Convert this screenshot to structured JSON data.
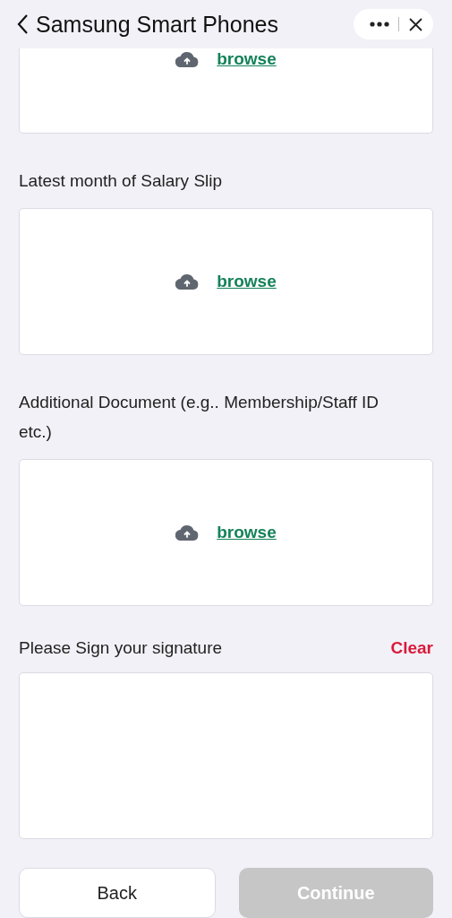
{
  "header": {
    "title": "Samsung Smart Phones"
  },
  "uploads": [
    {
      "browse": "browse"
    },
    {
      "label": "Latest month of Salary Slip",
      "browse": "browse"
    },
    {
      "label": "Additional Document (e.g.. Membership/Staff ID etc.)",
      "browse": "browse"
    }
  ],
  "signature": {
    "label": "Please Sign your signature",
    "clear": "Clear"
  },
  "buttons": [
    {
      "label": "Back",
      "kind": "secondary",
      "disabled": false
    },
    {
      "label": "Continue",
      "kind": "primary",
      "disabled": true
    }
  ]
}
